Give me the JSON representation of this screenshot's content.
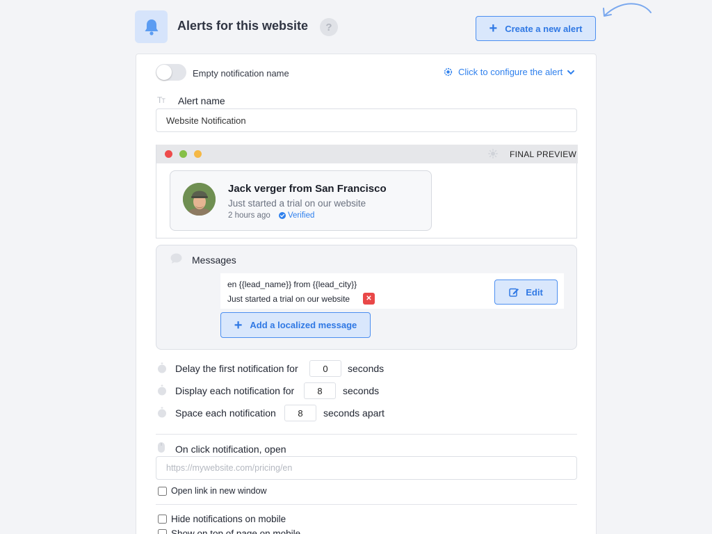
{
  "header": {
    "title": "Alerts for this website",
    "help_symbol": "?",
    "create_button_label": "Create a new alert"
  },
  "alert_settings": {
    "empty_name_toggle_label": "Empty notification name",
    "empty_name_toggle_on": false,
    "configure_link_label": "Click to configure the alert",
    "alert_name_label": "Alert name",
    "alert_name_value": "Website Notification"
  },
  "preview": {
    "label": "FINAL PREVIEW",
    "notification": {
      "name": "Jack verger from San Francisco",
      "message": "Just started a trial on our website",
      "time": "2 hours ago",
      "verified_label": "Verified"
    }
  },
  "messages": {
    "label": "Messages",
    "items": [
      {
        "line1": "en {{lead_name}} from {{lead_city}}",
        "line2": "Just started a trial on our website",
        "edit_label": "Edit"
      }
    ],
    "add_localized_label": "Add a localized message"
  },
  "timing": {
    "delay": {
      "label": "Delay the first notification for",
      "value": "0",
      "suffix": "seconds"
    },
    "display": {
      "label": "Display each notification for",
      "value": "8",
      "suffix": "seconds"
    },
    "space": {
      "label": "Space each notification",
      "value": "8",
      "suffix": "seconds apart"
    }
  },
  "on_click": {
    "label": "On click notification, open",
    "url_placeholder": "https://mywebsite.com/pricing/en",
    "new_window_label": "Open link in new window",
    "new_window_checked": false
  },
  "mobile": {
    "hide_label": "Hide notifications on mobile",
    "hide_checked": false,
    "top_label": "Show on top of page on mobile",
    "top_checked": false
  },
  "colors": {
    "accent": "#2f80ed",
    "button_bg": "#d9e7fc",
    "danger": "#e94848"
  },
  "icons": {
    "bell": "bell-icon",
    "plus": "plus-icon",
    "gear": "gear-icon",
    "chevron": "chevron-down-icon",
    "text": "text-format-icon",
    "sun": "brightness-icon",
    "chat": "chat-bubble-icon",
    "edit": "edit-icon",
    "close": "close-icon",
    "stopwatch": "stopwatch-icon",
    "mouse": "mouse-icon",
    "check": "check-circle-icon"
  }
}
